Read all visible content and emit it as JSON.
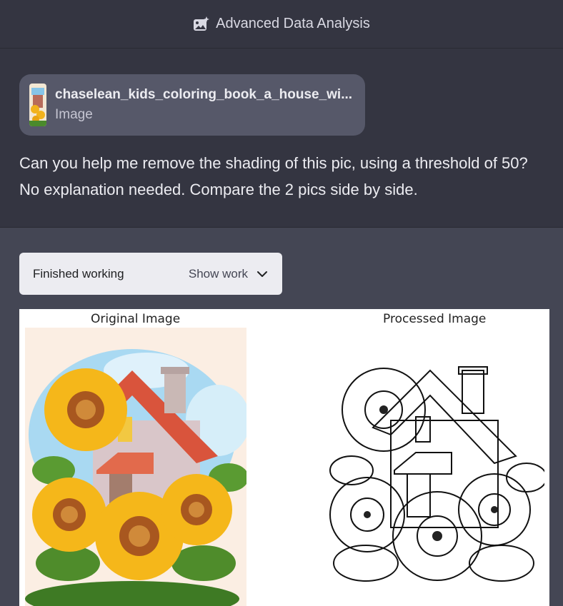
{
  "header": {
    "title": "Advanced Data Analysis",
    "icon": "data-analysis-icon"
  },
  "user_message": {
    "attachment": {
      "file_name": "chaselean_kids_coloring_book_a_house_wi...",
      "file_type": "Image"
    },
    "text": "Can you help me remove the shading of this pic, using a threshold of 50? No explanation needed. Compare the 2 pics side by side."
  },
  "assistant_message": {
    "work_status": "Finished working",
    "show_work_label": "Show work",
    "result": {
      "left_title": "Original Image",
      "right_title": "Processed Image"
    }
  },
  "colors": {
    "background": "#343541",
    "assistant_background": "#444654",
    "chip_background": "#565869",
    "work_box_background": "#ececf1"
  }
}
